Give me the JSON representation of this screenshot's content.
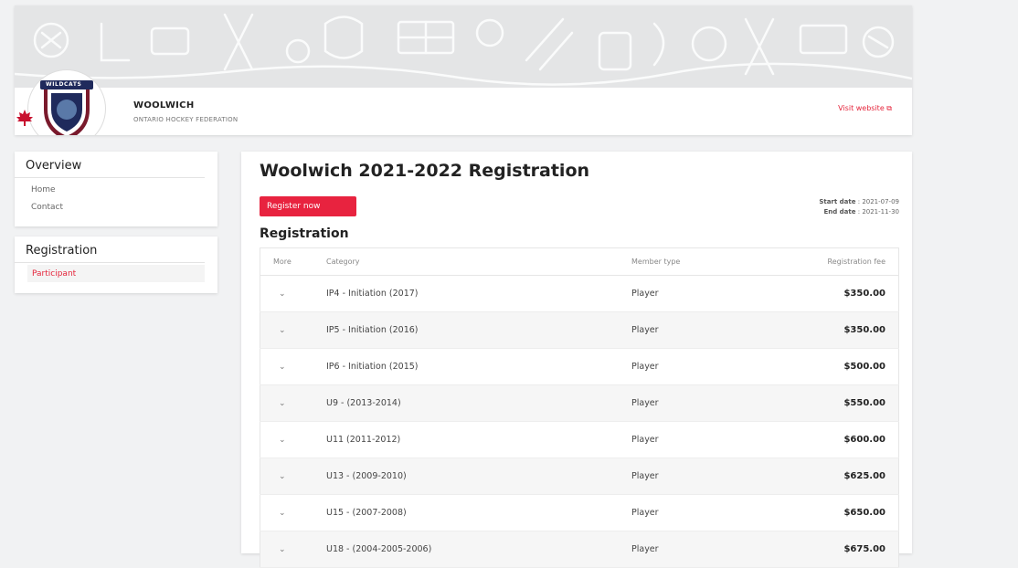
{
  "org": {
    "name": "WOOLWICH",
    "federation": "ONTARIO HOCKEY FEDERATION",
    "visit_link": "Visit website ⧉",
    "logo_text": "WILDCATS"
  },
  "sidebar": {
    "overview": {
      "title": "Overview",
      "items": [
        {
          "label": "Home"
        },
        {
          "label": "Contact"
        }
      ]
    },
    "registration": {
      "title": "Registration",
      "items": [
        {
          "label": "Participant",
          "active": true
        }
      ]
    }
  },
  "main": {
    "title": "Woolwich 2021-2022 Registration",
    "register_button": "Register now",
    "start_date_label": "Start date",
    "start_date": "2021-07-09",
    "end_date_label": "End date",
    "end_date": "2021-11-30",
    "section_title": "Registration",
    "table": {
      "headers": [
        "More",
        "Category",
        "Member type",
        "Registration fee"
      ],
      "rows": [
        {
          "category": "IP4 - Initiation (2017)",
          "member_type": "Player",
          "fee": "$350.00"
        },
        {
          "category": "IP5 - Initiation (2016)",
          "member_type": "Player",
          "fee": "$350.00"
        },
        {
          "category": "IP6 - Initiation (2015)",
          "member_type": "Player",
          "fee": "$500.00"
        },
        {
          "category": "U9 - (2013-2014)",
          "member_type": "Player",
          "fee": "$550.00"
        },
        {
          "category": "U11 (2011-2012)",
          "member_type": "Player",
          "fee": "$600.00"
        },
        {
          "category": "U13 - (2009-2010)",
          "member_type": "Player",
          "fee": "$625.00"
        },
        {
          "category": "U15 - (2007-2008)",
          "member_type": "Player",
          "fee": "$650.00"
        },
        {
          "category": "U18 - (2004-2005-2006)",
          "member_type": "Player",
          "fee": "$675.00"
        }
      ]
    }
  },
  "colors": {
    "accent": "#e5263c",
    "banner": "#e4e5e6",
    "logo_navy": "#1f2a5c"
  },
  "icons": {
    "expand": "chevron-down-icon",
    "external": "external-link-icon"
  }
}
